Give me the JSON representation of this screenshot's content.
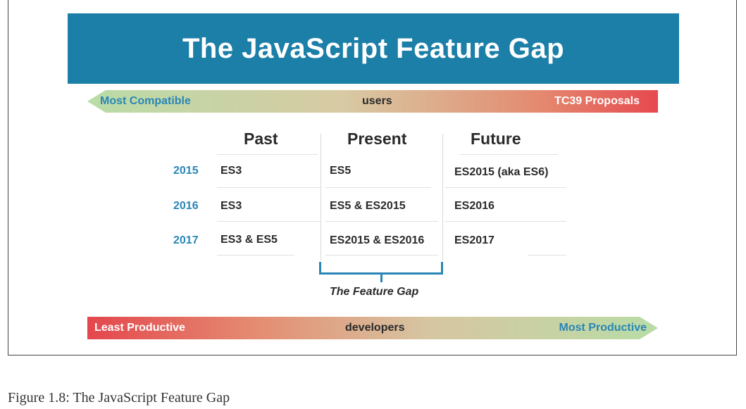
{
  "title": "The JavaScript Feature Gap",
  "top_arrow": {
    "left": "Most Compatible",
    "center": "users",
    "right": "TC39 Proposals"
  },
  "bottom_arrow": {
    "left": "Least Productive",
    "center": "developers",
    "right": "Most Productive"
  },
  "columns": [
    "Past",
    "Present",
    "Future"
  ],
  "rows": [
    {
      "year": "2015",
      "past": "ES3",
      "present": "ES5",
      "future": "ES2015 (aka ES6)"
    },
    {
      "year": "2016",
      "past": "ES3",
      "present": "ES5 & ES2015",
      "future": "ES2016"
    },
    {
      "year": "2017",
      "past": "ES3 & ES5",
      "present": "ES2015 & ES2016",
      "future": "ES2017"
    }
  ],
  "gap_label": "The Feature Gap",
  "caption": "Figure 1.8: The JavaScript Feature Gap",
  "colors": {
    "banner": "#1b7fa8",
    "accent_blue": "#2a86b5",
    "green": "#b9dca6",
    "red": "#e6494f"
  }
}
